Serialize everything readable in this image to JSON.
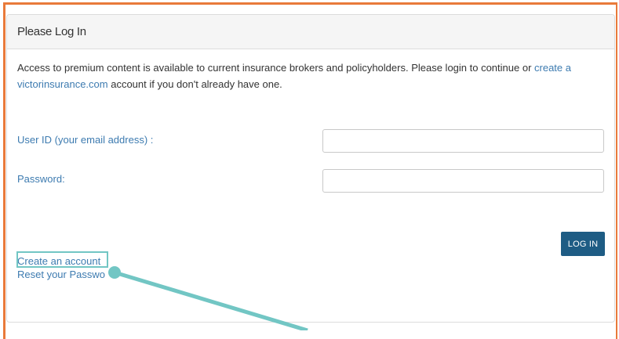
{
  "panel": {
    "title": "Please Log In",
    "intro_text": "Access to premium content is available to current insurance brokers and policyholders. Please login to continue or ",
    "intro_link": "create a victorinsurance.com",
    "intro_suffix": " account if you don't already have one."
  },
  "form": {
    "user_id_label": "User ID (your email address) :",
    "user_id_value": "",
    "password_label": "Password:",
    "password_value": "",
    "login_button": "LOG IN"
  },
  "links": {
    "create_account": "Create an account",
    "reset_password": "Reset your Passwo"
  },
  "colors": {
    "frame": "#e97a3a",
    "link": "#3d7bb0",
    "button": "#1e5c84",
    "annotation": "#72c6c4"
  }
}
